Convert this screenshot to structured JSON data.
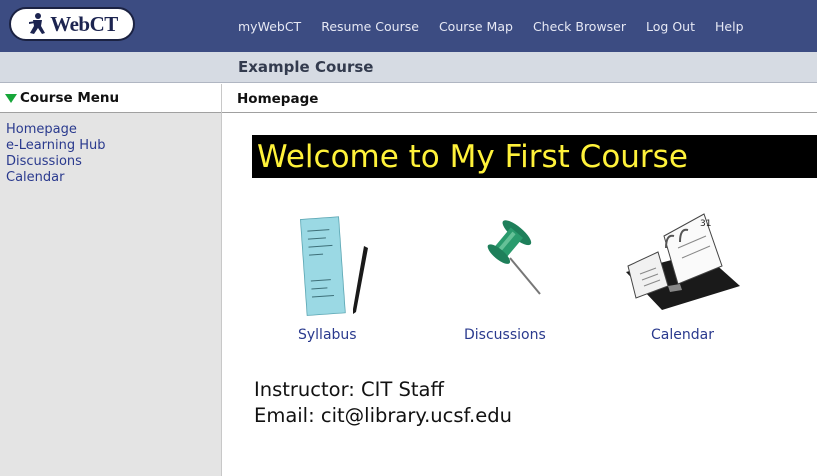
{
  "logo": {
    "text": "WebCT"
  },
  "topnav": {
    "items": [
      "myWebCT",
      "Resume Course",
      "Course Map",
      "Check Browser",
      "Log Out",
      "Help"
    ]
  },
  "course": {
    "title": "Example Course"
  },
  "sidebar": {
    "menu_title": "Course Menu",
    "items": [
      "Homepage",
      "e-Learning Hub",
      "Discussions",
      "Calendar"
    ]
  },
  "breadcrumb": {
    "current": "Homepage"
  },
  "main": {
    "welcome": "Welcome to My First Course",
    "icons": [
      {
        "label": "Syllabus",
        "icon": "syllabus-icon"
      },
      {
        "label": "Discussions",
        "icon": "pushpin-icon"
      },
      {
        "label": "Calendar",
        "icon": "calendar-icon"
      }
    ],
    "instructor": "Instructor: CIT Staff",
    "email": "Email: cit@library.ucsf.edu"
  },
  "colors": {
    "topbar": "#3c4c82",
    "titleband": "#d6dbe3",
    "sidebar": "#e4e4e4",
    "link": "#2a3a8e",
    "welcome_text": "#fff23a",
    "menu_triangle": "#17a63a"
  }
}
